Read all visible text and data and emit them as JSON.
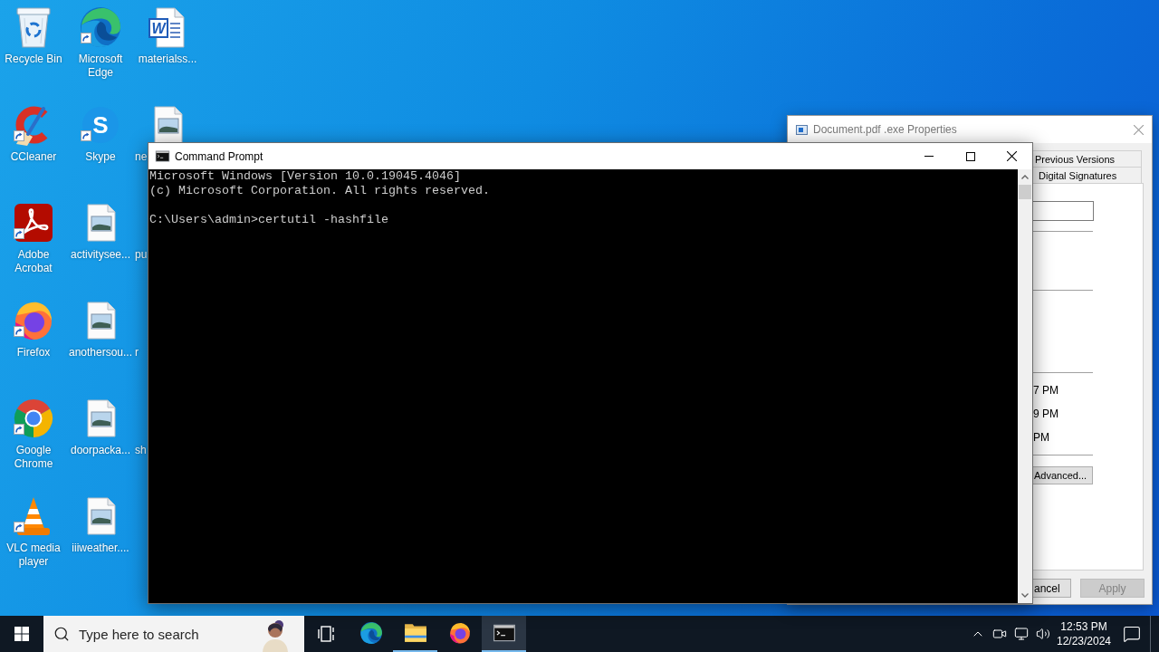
{
  "desktop": {
    "icons": [
      {
        "label": "Recycle Bin",
        "kind": "recycle-bin",
        "shortcut": false,
        "clipped": false
      },
      {
        "label": "Microsoft Edge",
        "kind": "edge",
        "shortcut": true,
        "clipped": false
      },
      {
        "label": "materialss...",
        "kind": "word-document",
        "glyph": "W",
        "shortcut": false,
        "clipped": false
      },
      {
        "label": "CCleaner",
        "kind": "ccleaner",
        "shortcut": true,
        "clipped": false
      },
      {
        "label": "Skype",
        "kind": "skype",
        "glyph": "S",
        "shortcut": true,
        "clipped": false
      },
      {
        "label": "ne",
        "kind": "image-file",
        "shortcut": false,
        "clipped": true
      },
      {
        "label": "Adobe Acrobat",
        "kind": "acrobat",
        "shortcut": true,
        "clipped": false
      },
      {
        "label": "activitysee...",
        "kind": "image-file",
        "shortcut": false,
        "clipped": false
      },
      {
        "label": "pu",
        "kind": "label-only",
        "clipped": true
      },
      {
        "label": "Firefox",
        "kind": "firefox",
        "shortcut": true,
        "clipped": false
      },
      {
        "label": "anothersou...",
        "kind": "image-file",
        "shortcut": false,
        "clipped": false
      },
      {
        "label": "r",
        "kind": "label-only",
        "clipped": true
      },
      {
        "label": "Google Chrome",
        "kind": "chrome",
        "shortcut": true,
        "clipped": false
      },
      {
        "label": "doorpacka...",
        "kind": "image-file",
        "shortcut": false,
        "clipped": false
      },
      {
        "label": "sh",
        "kind": "label-only",
        "clipped": true
      },
      {
        "label": "VLC media player",
        "kind": "vlc",
        "shortcut": true,
        "clipped": false
      },
      {
        "label": "iiiweather....",
        "kind": "image-file",
        "shortcut": false,
        "clipped": false
      }
    ]
  },
  "cmd_window": {
    "title": "Command Prompt",
    "output": [
      "Microsoft Windows [Version 10.0.19045.4046]",
      "(c) Microsoft Corporation. All rights reserved."
    ],
    "prompt": "C:\\Users\\admin>",
    "command": "certutil -hashfile"
  },
  "properties_window": {
    "title": "Document.pdf .exe Properties",
    "tabs": [
      {
        "label": "Previous Versions",
        "selected": false
      },
      {
        "label": "Digital Signatures",
        "selected": false
      }
    ],
    "times": [
      "7 PM",
      "9 PM",
      "PM"
    ],
    "advanced_button": "Advanced...",
    "buttons": [
      {
        "label": "ancel",
        "disabled": false
      },
      {
        "label": "Apply",
        "disabled": true
      }
    ]
  },
  "taskbar": {
    "search": {
      "placeholder": "Type here to search"
    },
    "apps": [
      {
        "kind": "edge",
        "running": false,
        "selected": false
      },
      {
        "kind": "file-explorer",
        "running": true,
        "selected": false
      },
      {
        "kind": "firefox",
        "running": false,
        "selected": false
      },
      {
        "kind": "command-prompt",
        "running": true,
        "selected": true
      }
    ],
    "clock": {
      "time": "12:53 PM",
      "date": "12/23/2024"
    }
  }
}
